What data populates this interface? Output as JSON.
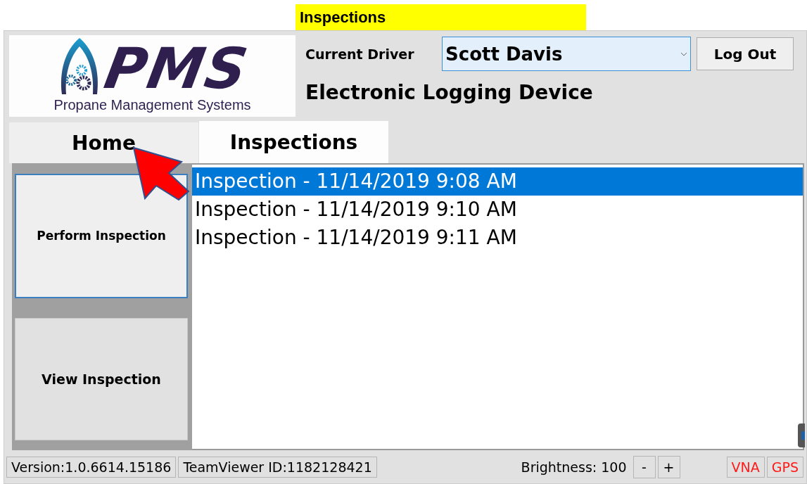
{
  "page_title": "Inspections",
  "logo": {
    "name": "PMS",
    "tagline": "Propane Management Systems"
  },
  "driver": {
    "label": "Current Driver",
    "value": "Scott Davis"
  },
  "logout_button": "Log Out",
  "subtitle": "Electronic Logging Device",
  "tabs": [
    {
      "label": "Home",
      "selected": false
    },
    {
      "label": "Inspections",
      "selected": true
    }
  ],
  "actions": [
    "Perform Inspection",
    "View Inspection"
  ],
  "inspections": [
    {
      "label": "Inspection - 11/14/2019 9:08 AM",
      "selected": true
    },
    {
      "label": "Inspection - 11/14/2019 9:10 AM",
      "selected": false
    },
    {
      "label": "Inspection - 11/14/2019 9:11 AM",
      "selected": false
    }
  ],
  "status_bar": {
    "version": "Version:1.0.6614.15186",
    "teamviewer": "TeamViewer ID:1182128421",
    "brightness": "Brightness: 100",
    "minus": "-",
    "plus": "+",
    "indicators": [
      "VNA",
      "GPS"
    ]
  }
}
